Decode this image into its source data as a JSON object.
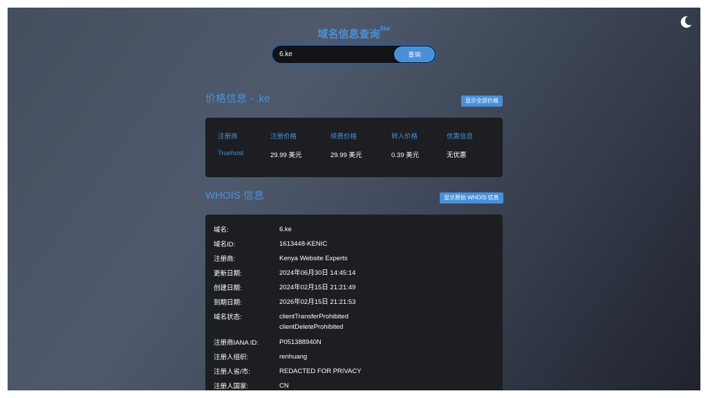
{
  "header": {
    "title": "域名信息查询",
    "title_sup": "6ke"
  },
  "theme_toggle": {
    "icon": "moon-icon"
  },
  "search": {
    "value": "6.ke",
    "button_label": "查询"
  },
  "price_section": {
    "title": "价格信息 - .ke",
    "show_all_label": "显示全部价格",
    "columns": [
      "注册商",
      "注册价格",
      "续费价格",
      "转入价格",
      "优惠信息"
    ],
    "rows": [
      {
        "registrar": "Truehost",
        "register": "29.99 美元",
        "renew": "29.99 美元",
        "transfer": "0.39 美元",
        "promo": "无优惠"
      }
    ]
  },
  "whois_section": {
    "title": "WHOIS 信息",
    "raw_label": "显示原始 WHOIS 信息",
    "rows": [
      {
        "key": "域名:",
        "value": "6.ke"
      },
      {
        "key": "域名ID:",
        "value": "1613448-KENIC"
      },
      {
        "key": "注册商:",
        "value": "Kenya Website Experts"
      },
      {
        "key": "更新日期:",
        "value": "2024年06月30日 14:45:14"
      },
      {
        "key": "创建日期:",
        "value": "2024年02月15日 21:21:49"
      },
      {
        "key": "到期日期:",
        "value": "2026年02月15日 21:21:53"
      },
      {
        "key": "域名状态:",
        "value": "clientTransferProhibited",
        "value2": "clientDeleteProhibited"
      },
      {
        "key": "注册商IANA ID:",
        "value": "P051388940N"
      },
      {
        "key": "注册人组织:",
        "value": "renhuang"
      },
      {
        "key": "注册人省/市:",
        "value": "REDACTED FOR PRIVACY"
      },
      {
        "key": "注册人国家:",
        "value": "CN"
      }
    ]
  },
  "colors": {
    "accent": "#4a90d9",
    "card_bg": "#1d1e22"
  }
}
